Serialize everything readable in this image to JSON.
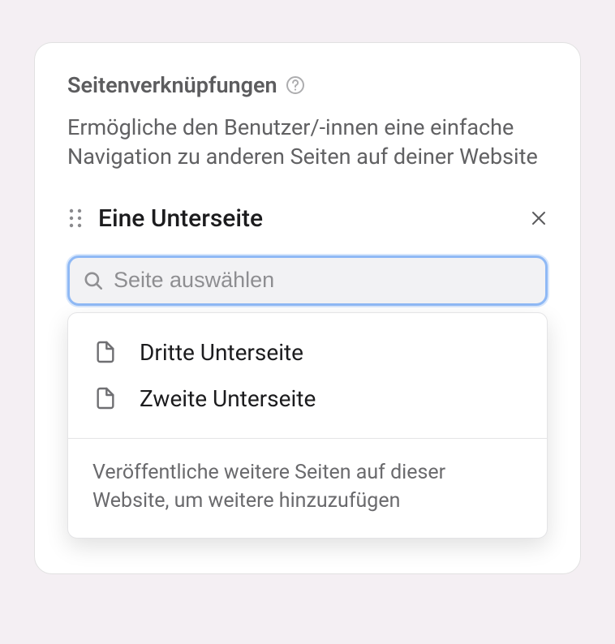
{
  "panel": {
    "title": "Seitenverknüpfungen",
    "description": "Ermögliche den Benutzer/-innen eine einfache Navigation zu anderen Seiten auf deiner Website"
  },
  "selected_item": {
    "label": "Eine Unterseite"
  },
  "search": {
    "placeholder": "Seite auswählen",
    "value": ""
  },
  "dropdown": {
    "items": [
      {
        "label": "Dritte Unterseite"
      },
      {
        "label": "Zweite Unterseite"
      }
    ],
    "footer": "Veröffentliche weitere Seiten auf dieser Website, um weitere hinzuzufügen"
  }
}
